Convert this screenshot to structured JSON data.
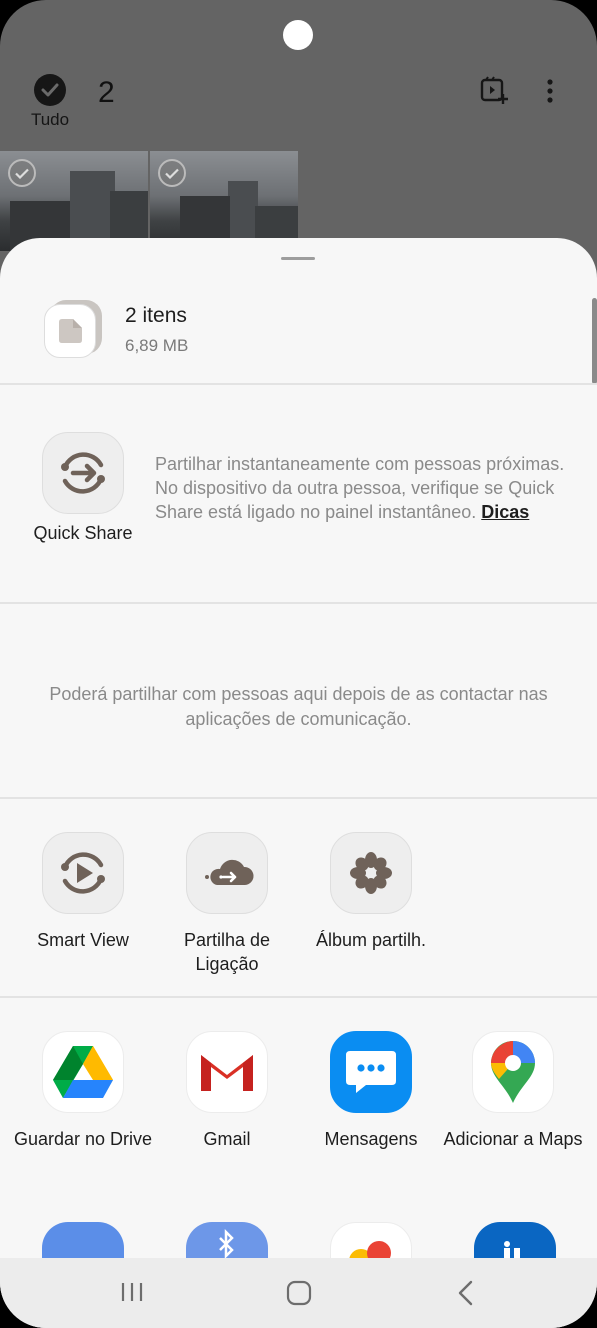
{
  "gallery": {
    "select_all_label": "Tudo",
    "selected_count": "2"
  },
  "share_sheet": {
    "file_title": "2 itens",
    "file_size": "6,89 MB",
    "quick_share": {
      "label": "Quick Share",
      "description": "Partilhar instantaneamente com pessoas próximas. No dispositivo da outra pessoa, verifique se Quick Share está ligado no painel instantâneo.",
      "tips_link": "Dicas"
    },
    "people_note": "Poderá partilhar com pessoas aqui depois de as contactar nas aplicações de comunicação.",
    "samsung_options": [
      {
        "label": "Smart View",
        "icon": "smart-view-icon"
      },
      {
        "label": "Partilha de Ligação",
        "icon": "link-sharing-cloud-icon"
      },
      {
        "label": "Álbum partilh.",
        "icon": "shared-album-flower-icon"
      }
    ],
    "apps": [
      {
        "label": "Guardar no Drive",
        "icon": "google-drive-icon"
      },
      {
        "label": "Gmail",
        "icon": "gmail-icon"
      },
      {
        "label": "Mensagens",
        "icon": "messages-icon"
      },
      {
        "label": "Adicionar a Maps",
        "icon": "google-maps-icon"
      }
    ]
  },
  "colors": {
    "scrim": "#646464",
    "sheet_bg": "#f7f7f7",
    "text_primary": "#1e1e1e",
    "text_secondary": "#8a8a8a",
    "icon_brown": "#6f6259"
  }
}
